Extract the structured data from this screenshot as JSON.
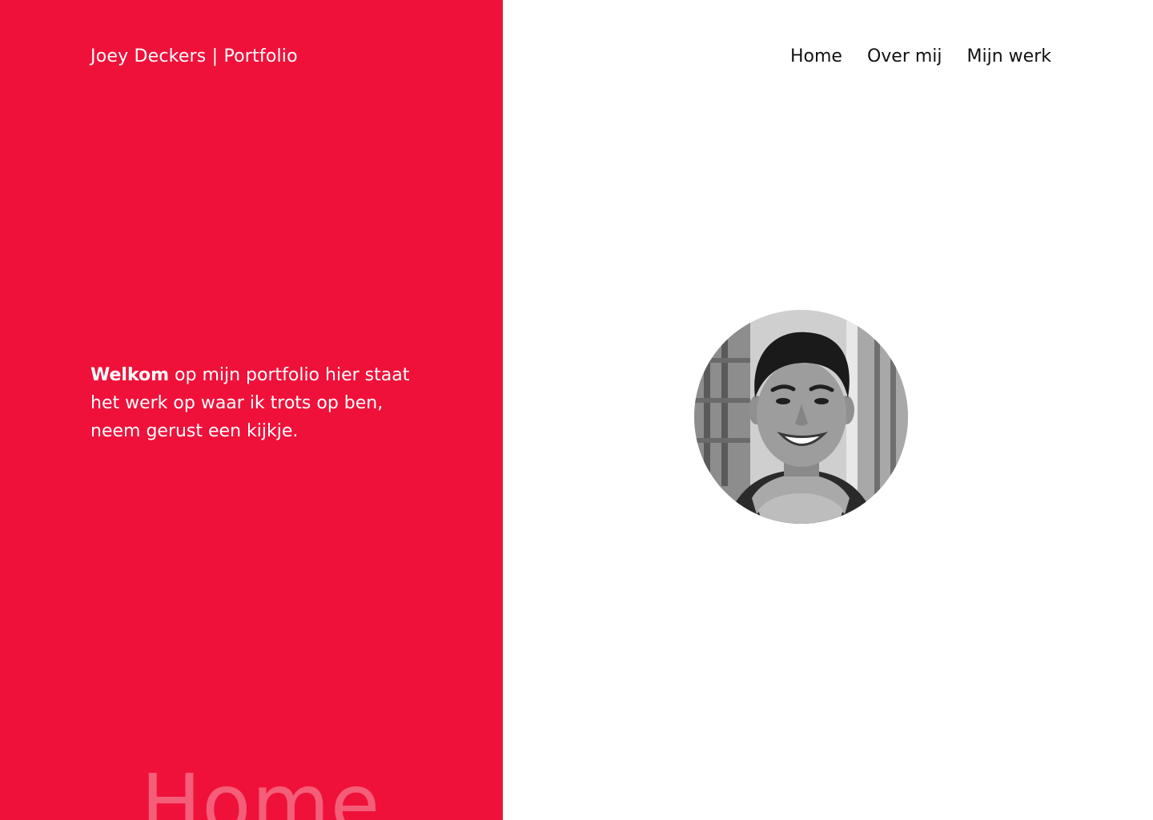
{
  "header": {
    "site_title": "Joey Deckers | Portfolio"
  },
  "nav": {
    "items": [
      {
        "label": "Home"
      },
      {
        "label": "Over mij"
      },
      {
        "label": "Mijn werk"
      }
    ]
  },
  "hero": {
    "intro_bold": "Welkom",
    "intro_rest": " op mijn portfolio hier staat het werk op waar ik trots op ben, neem gerust een kijkje.",
    "watermark": "Home"
  },
  "colors": {
    "accent": "#ef113a",
    "background": "#ffffff",
    "nav_text": "#111111"
  }
}
